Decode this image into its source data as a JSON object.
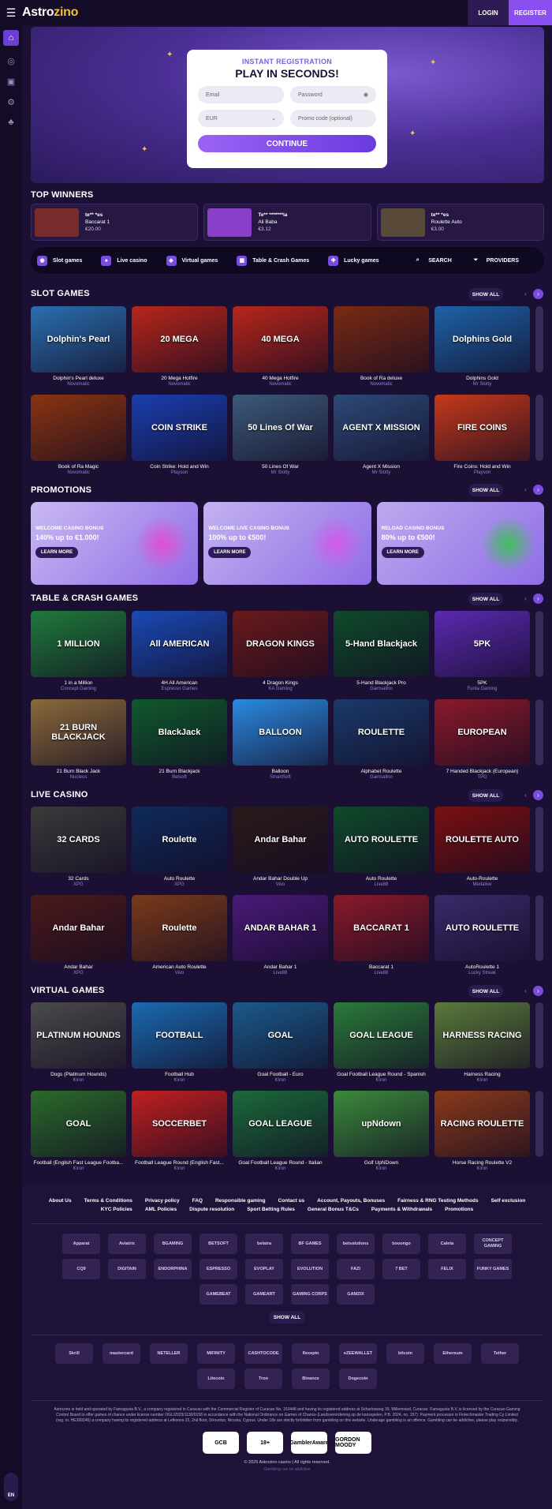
{
  "header": {
    "logo_a": "Astro",
    "logo_b": "zino",
    "login": "LOGIN",
    "register": "REGISTER"
  },
  "sidebar": {
    "icons": [
      "home-icon",
      "slots-icon",
      "live-icon",
      "virtual-icon",
      "promo-icon"
    ]
  },
  "hero": {
    "subtitle": "INSTANT REGISTRATION",
    "title": "PLAY IN SECONDS!",
    "email_placeholder": "Email",
    "password_placeholder": "Password",
    "currency": "EUR",
    "promo_placeholder": "Promo code (optional)",
    "continue": "CONTINUE"
  },
  "winners": {
    "title": "TOP WINNERS",
    "items": [
      {
        "name": "te** *es",
        "game": "Baccarat 1",
        "amount": "€20.00",
        "color": "#7a2c2c"
      },
      {
        "name": "Te** *******ia",
        "game": "Ali Baba",
        "amount": "€3.12",
        "color": "#8a3fc9"
      },
      {
        "name": "te** *es",
        "game": "Roulette Auto",
        "amount": "€3.00",
        "color": "#5a4a3a"
      }
    ]
  },
  "categories": [
    {
      "label": "Slot games",
      "icon": "slot-icon"
    },
    {
      "label": "Live casino",
      "icon": "live-icon"
    },
    {
      "label": "Virtual games",
      "icon": "virtual-icon"
    },
    {
      "label": "Table & Crash Games",
      "icon": "table-icon"
    },
    {
      "label": "Lucky games",
      "icon": "lucky-icon"
    },
    {
      "label": "SEARCH",
      "icon": "search-icon"
    },
    {
      "label": "PROVIDERS",
      "icon": "filter-icon"
    }
  ],
  "show_all": "SHOW ALL",
  "slots": {
    "title": "SLOT GAMES",
    "row1": [
      {
        "name": "Dolphin's Pearl deluxe",
        "provider": "Novomatic",
        "art": "Dolphin's Pearl",
        "bg": "#2a6fb0"
      },
      {
        "name": "20 Mega Hotfire",
        "provider": "Novomatic",
        "art": "20 MEGA",
        "bg": "#b8261a"
      },
      {
        "name": "40 Mega Hotfire",
        "provider": "Novomatic",
        "art": "40 MEGA",
        "bg": "#b8261a"
      },
      {
        "name": "Book of Ra deluxe",
        "provider": "Novomatic",
        "art": "",
        "bg": "#7a2a12"
      },
      {
        "name": "Dolphins Gold",
        "provider": "Mr Slotty",
        "art": "Dolphins Gold",
        "bg": "#1d62a8"
      }
    ],
    "row2": [
      {
        "name": "Book of Ra Magic",
        "provider": "Novomatic",
        "art": "",
        "bg": "#8a3410"
      },
      {
        "name": "Coin Strike: Hold and Win",
        "provider": "Playson",
        "art": "COIN STRIKE",
        "bg": "#1a3fb0"
      },
      {
        "name": "50 Lines Of War",
        "provider": "Mr Slotty",
        "art": "50 Lines Of War",
        "bg": "#3b5a7a"
      },
      {
        "name": "Agent X Mission",
        "provider": "Mr Slotty",
        "art": "AGENT X MISSION",
        "bg": "#2c4a78"
      },
      {
        "name": "Fire Coins: Hold and Win",
        "provider": "Playson",
        "art": "FIRE COINS",
        "bg": "#c5391a"
      }
    ]
  },
  "promotions": {
    "title": "PROMOTIONS",
    "items": [
      {
        "title": "WELCOME CASINO BONUS",
        "amount": "140% up to €1.000!",
        "cta": "LEARN MORE",
        "bg": "#c9b8f3",
        "accent": "#e04fd0"
      },
      {
        "title": "WELCOME LIVE CASINO BONUS",
        "amount": "100% up to €500!",
        "cta": "LEARN MORE",
        "bg": "#c3b2f0",
        "accent": "#d25ae8"
      },
      {
        "title": "RELOAD CASINO BONUS",
        "amount": "80% up to €500!",
        "cta": "LEARN MORE",
        "bg": "#bda9ef",
        "accent": "#3fbf5a"
      }
    ]
  },
  "table": {
    "title": "TABLE & CRASH GAMES",
    "row1": [
      {
        "name": "1 in a Million",
        "provider": "Concept Gaming",
        "art": "1 MILLION",
        "bg": "#1f7a3a"
      },
      {
        "name": "4H All American",
        "provider": "Espresso Games",
        "art": "All AMERICAN",
        "bg": "#1a4ab5"
      },
      {
        "name": "4 Dragon Kings",
        "provider": "KA Gaming",
        "art": "DRAGON KINGS",
        "bg": "#6a1a1a"
      },
      {
        "name": "5-Hand Blackjack Pro",
        "provider": "Gamsalino",
        "art": "5-Hand Blackjack",
        "bg": "#0f4a2a"
      },
      {
        "name": "5PK",
        "provider": "Funta Gaming",
        "art": "5PK",
        "bg": "#5a2ab0"
      }
    ],
    "row2": [
      {
        "name": "21 Burn Black Jack",
        "provider": "Nucleus",
        "art": "21 BURN BLACKJACK",
        "bg": "#8a6a3a"
      },
      {
        "name": "21 Burn Blackjack",
        "provider": "Betsoft",
        "art": "BlackJack",
        "bg": "#0f5a2c"
      },
      {
        "name": "Balloon",
        "provider": "SmartSoft",
        "art": "BALLOON",
        "bg": "#2a8ae0"
      },
      {
        "name": "Alphabet Roulette",
        "provider": "Gamsalino",
        "art": "ROULETTE",
        "bg": "#1a3a6a"
      },
      {
        "name": "7 Handed Blackjack (European)",
        "provider": "TPG",
        "art": "EUROPEAN",
        "bg": "#8a1a2a"
      }
    ]
  },
  "live": {
    "title": "LIVE CASINO",
    "row1": [
      {
        "name": "32 Cards",
        "provider": "XPG",
        "art": "32 CARDS",
        "bg": "#3a3a3a"
      },
      {
        "name": "Auto Roulette",
        "provider": "XPG",
        "art": "Roulette",
        "bg": "#0f2a5a"
      },
      {
        "name": "Andar Bahar Double Up",
        "provider": "Vivo",
        "art": "Andar Bahar",
        "bg": "#2a1a1a"
      },
      {
        "name": "Auto Roulette",
        "provider": "Live88",
        "art": "AUTO ROULETTE",
        "bg": "#0f4a2a"
      },
      {
        "name": "Auto-Roulette",
        "provider": "Medalive",
        "art": "ROULETTE AUTO",
        "bg": "#7a1010"
      }
    ],
    "row2": [
      {
        "name": "Andar Bahar",
        "provider": "XPG",
        "art": "Andar Bahar",
        "bg": "#4a1a1a"
      },
      {
        "name": "American Auto Roulette",
        "provider": "Vivo",
        "art": "Roulette",
        "bg": "#7a3a1a"
      },
      {
        "name": "Andar Bahar 1",
        "provider": "Live88",
        "art": "ANDAR BAHAR 1",
        "bg": "#4a1a7a"
      },
      {
        "name": "Baccarat 1",
        "provider": "Live88",
        "art": "BACCARAT 1",
        "bg": "#8a1a2a"
      },
      {
        "name": "AutoRoulette 1",
        "provider": "Lucky Streak",
        "art": "AUTO ROULETTE",
        "bg": "#3a2a6a"
      }
    ]
  },
  "virtual": {
    "title": "VIRTUAL GAMES",
    "row1": [
      {
        "name": "Dogs (Platinum Hounds)",
        "provider": "Kiron",
        "art": "PLATINUM HOUNDS",
        "bg": "#4a4a4a"
      },
      {
        "name": "Football Hub",
        "provider": "Kiron",
        "art": "FOOTBALL",
        "bg": "#1a6ab0"
      },
      {
        "name": "Goal Football - Euro",
        "provider": "Kiron",
        "art": "GOAL",
        "bg": "#1a5a8a"
      },
      {
        "name": "Goal Football League Round - Spanish",
        "provider": "Kiron",
        "art": "GOAL LEAGUE",
        "bg": "#2a7a3a"
      },
      {
        "name": "Harness Racing",
        "provider": "Kiron",
        "art": "HARNESS RACING",
        "bg": "#5a7a3a"
      }
    ],
    "row2": [
      {
        "name": "Football (English Fast League Footba...",
        "provider": "Kiron",
        "art": "GOAL",
        "bg": "#2a6a2a"
      },
      {
        "name": "Football League Round (English Fast...",
        "provider": "Kiron",
        "art": "SOCCERBET",
        "bg": "#c02020"
      },
      {
        "name": "Goal Football League Round - Italian",
        "provider": "Kiron",
        "art": "GOAL LEAGUE",
        "bg": "#1a6a3a"
      },
      {
        "name": "Golf UpNDown",
        "provider": "Kiron",
        "art": "upNdown",
        "bg": "#3a8a3a"
      },
      {
        "name": "Horse Racing Roulette V2",
        "provider": "Kiron",
        "art": "RACING ROULETTE",
        "bg": "#8a3a1a"
      }
    ]
  },
  "footer": {
    "links": [
      "About Us",
      "Terms & Conditions",
      "Privacy policy",
      "FAQ",
      "Responsible gaming",
      "Contact us",
      "Account, Payouts, Bonuses",
      "Fairness & RNG Testing Methods",
      "Self exclusion",
      "KYC Policies",
      "AML Policies",
      "Dispute resolution",
      "Sport Betting Rules",
      "General Bonus T&Cs",
      "Payments & Withdrawals",
      "Promotions"
    ],
    "providers": [
      "Apparat",
      "Aviatrix",
      "BGAMING",
      "BETSOFT",
      "belatra",
      "BF GAMES",
      "betsolutions",
      "booongo",
      "Caleta",
      "CONCEPT GAMING",
      "CQ9",
      "DIGITAIN",
      "ENDORPHINA",
      "ESPRESSO",
      "EVOPLAY",
      "EVOLUTION",
      "FAZI",
      "7 BET",
      "FELIX",
      "FUNKY GAMES",
      "GAMEBEAT",
      "GAMEART",
      "GAMING CORPS",
      "GAMZIX"
    ],
    "show_all": "SHOW ALL",
    "payments": [
      "Skrill",
      "mastercard",
      "NETELLER",
      "MIFINITY",
      "CASHTOCODE",
      "flexepin",
      "eZEEWALLET",
      "bitcoin",
      "Ethereum",
      "Tether",
      "Litecoin",
      "Tron",
      "Binance",
      "Dogecoin"
    ],
    "legal": "Astrozino is held and operated by Famagusta B.V., a company registered in Curacao with the Commercial Register of Curacao No. 153448 and having its registered address at Scharlooweg 39, Willemstad, Curacao. Famagusta B.V. is licensed by the Curacao Gaming Control Board to offer games of chance under license number OGL/2023/1130/0158 in accordance with the National Ordinance on Games of Chance (Landsverordening op de kansspelen, P.B. 2024, no. 157). Payment processor is Fintechmaster Trading Cy Limited (reg. nr. HE399246) a company having its registered address at Lefkonos 22, 2nd floor, Strovolos, Nicosia, Cyprus. Under 18s are strictly forbidden from gambling on this website. Underage gambling is an offence. Gambling can be addictive, please play responsibly.",
    "badges": [
      "GCB",
      "18+",
      "GamblerAware",
      "GORDON MOODY"
    ],
    "copyright": "© 2025 Astrozino casino | All rights reserved.",
    "tagline": "Gambling can be addictive"
  },
  "language": "EN"
}
